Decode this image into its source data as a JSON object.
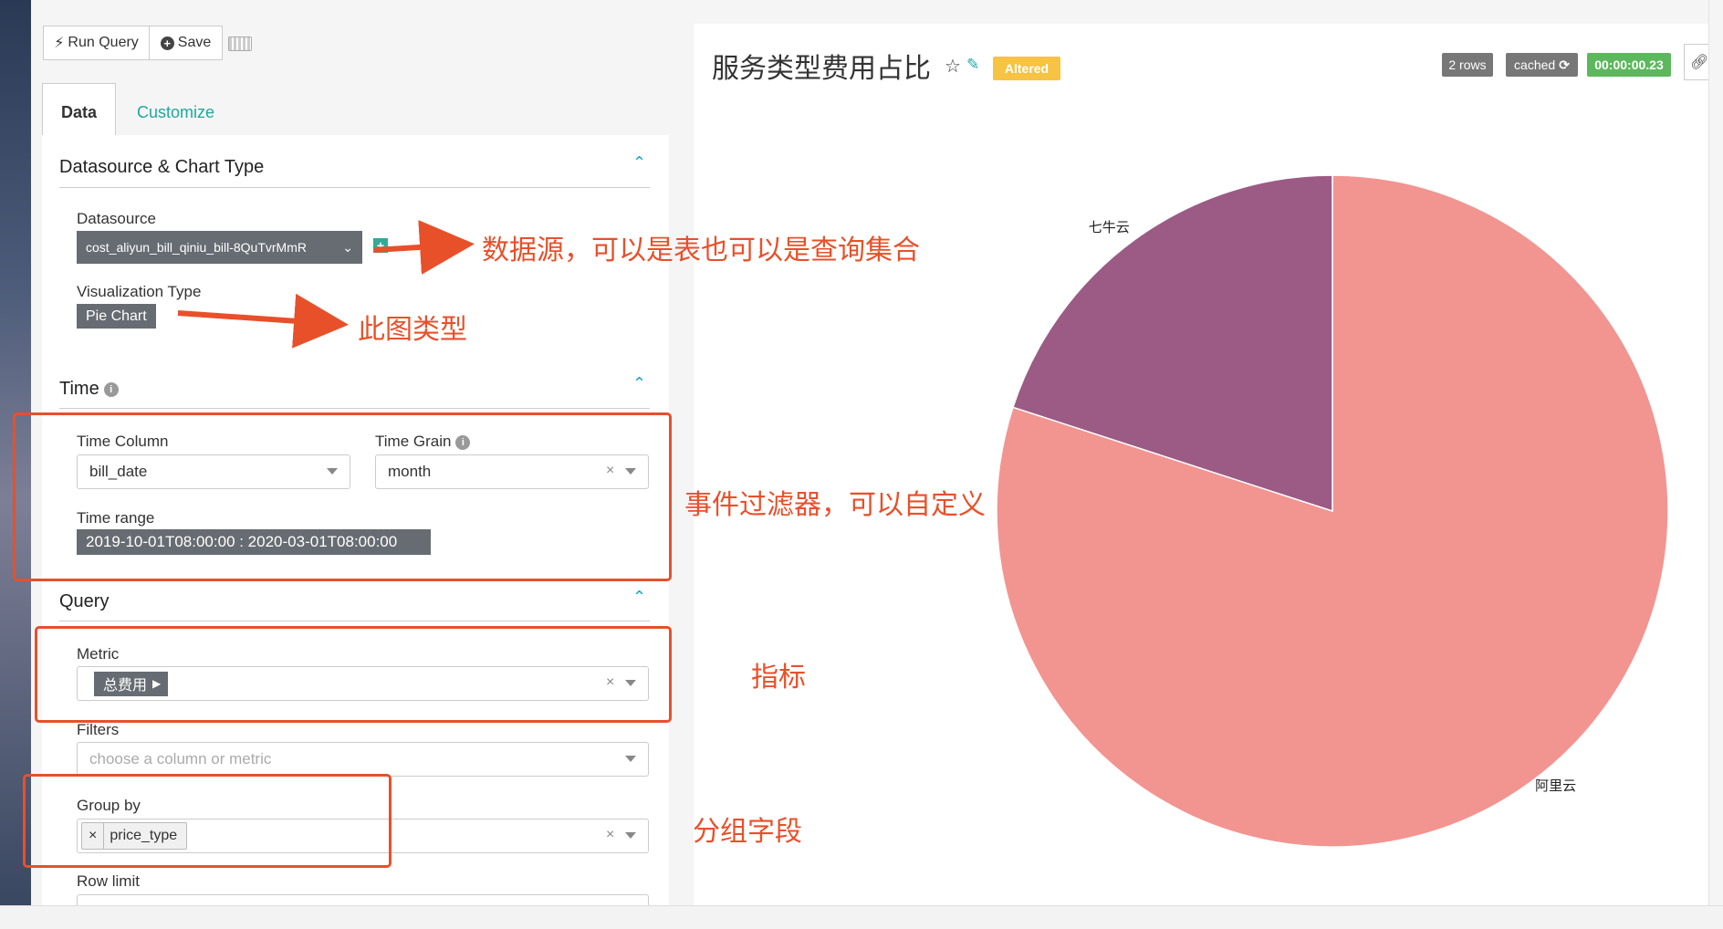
{
  "toolbar": {
    "run_query_label": "Run Query",
    "save_label": "Save",
    "run_icon": "bolt-icon",
    "save_icon": "plus-circle-icon",
    "keyboard_icon": "keyboard-icon"
  },
  "tabs": [
    {
      "label": "Data",
      "active": true
    },
    {
      "label": "Customize",
      "active": false
    }
  ],
  "sections": {
    "datasource": {
      "title": "Datasource & Chart Type",
      "datasource_label": "Datasource",
      "datasource_value": "cost_aliyun_bill_qiniu_bill-8QuTvrMmR",
      "viz_label": "Visualization Type",
      "viz_value": "Pie Chart"
    },
    "time": {
      "title": "Time",
      "time_column_label": "Time Column",
      "time_column_value": "bill_date",
      "time_grain_label": "Time Grain",
      "time_grain_value": "month",
      "time_range_label": "Time range",
      "time_range_value": "2019-10-01T08:00:00 : 2020-03-01T08:00:00"
    },
    "query": {
      "title": "Query",
      "metric_label": "Metric",
      "metric_value": "总费用",
      "filters_label": "Filters",
      "filters_placeholder": "choose a column or metric",
      "group_by_label": "Group by",
      "group_by_value": "price_type",
      "row_limit_label": "Row limit"
    }
  },
  "annotations": {
    "datasource_note": "数据源，可以是表也可以是查询集合",
    "viz_note": "此图类型",
    "time_note": "事件过滤器，可以自定义",
    "metric_note": "指标",
    "group_note": "分组字段"
  },
  "chart_header": {
    "title": "服务类型费用占比",
    "star_icon": "star-icon",
    "edit_icon": "edit-icon",
    "altered_label": "Altered",
    "rows_badge": "2 rows",
    "cached_badge": "cached",
    "time_badge": "00:00:00.23",
    "refresh_icon": "refresh-icon",
    "link_icon": "link-icon",
    "colors": {
      "rows": "#777777",
      "cached": "#777777",
      "time": "#5cb85c",
      "altered": "#f0ad4e"
    }
  },
  "chart_data": {
    "type": "pie",
    "categories": [
      "阿里云",
      "七牛云"
    ],
    "values": [
      80,
      20
    ],
    "colors": [
      "#f29490",
      "#9b5b85"
    ]
  }
}
